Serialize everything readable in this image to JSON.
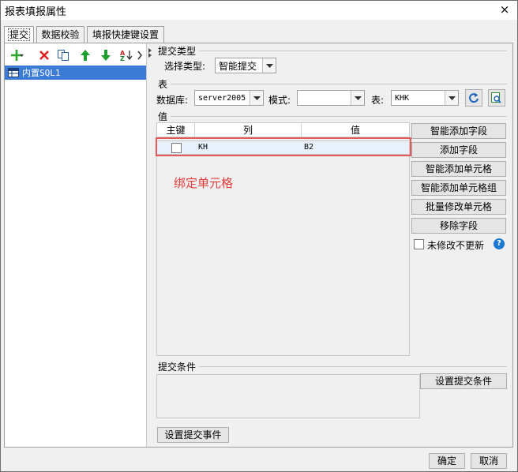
{
  "window": {
    "title": "报表填报属性",
    "close_icon": "×"
  },
  "tabs": [
    {
      "label": "提交",
      "active": true
    },
    {
      "label": "数据校验",
      "active": false
    },
    {
      "label": "填报快捷键设置",
      "active": false
    }
  ],
  "left_pane": {
    "toolbar": [
      "add-icon",
      "delete-icon",
      "copy-icon",
      "move-up-icon",
      "move-down-icon",
      "sort-icon",
      "more-icon"
    ],
    "datasource": "内置SQL1"
  },
  "submit_type": {
    "section": "提交类型",
    "label": "选择类型:",
    "value": "智能提交"
  },
  "table_section": {
    "section": "表",
    "db_label": "数据库:",
    "db_value": "server2005",
    "schema_label": "模式:",
    "schema_value": "",
    "table_label": "表:",
    "table_value": "KHK"
  },
  "value_section": {
    "section": "值",
    "columns": [
      "主键",
      "列",
      "值"
    ],
    "rows": [
      {
        "key": false,
        "column": "KH",
        "value": "B2"
      }
    ],
    "annotation": "绑定单元格"
  },
  "side_buttons": [
    "智能添加字段",
    "添加字段",
    "智能添加单元格",
    "智能添加单元格组",
    "批量修改单元格",
    "移除字段"
  ],
  "no_update_label": "未修改不更新",
  "submit_condition": {
    "section": "提交条件",
    "button": "设置提交条件"
  },
  "submit_event_button": "设置提交事件",
  "footer": {
    "ok": "确定",
    "cancel": "取消"
  },
  "colors": {
    "selection": "#3b7bd6",
    "highlight": "#e25a5a",
    "annotation": "#e03c3c"
  }
}
